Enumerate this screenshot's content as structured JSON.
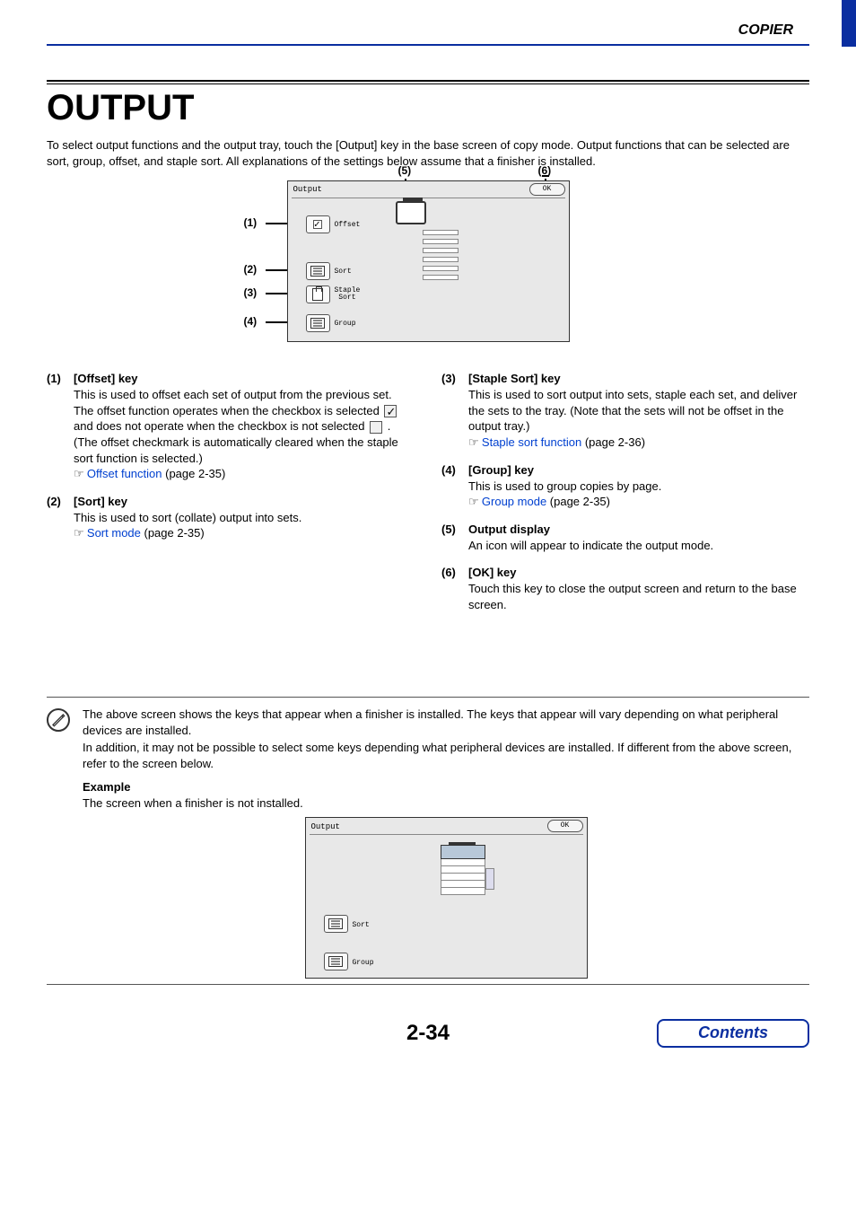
{
  "header": {
    "section": "COPIER"
  },
  "title": "OUTPUT",
  "intro": "To select output functions and the output tray, touch the [Output] key in the base screen of copy mode. Output functions that can be selected are sort, group, offset, and staple sort. All explanations of the settings below assume that a finisher is installed.",
  "diagram": {
    "panel_title": "Output",
    "ok": "OK",
    "btn_offset": "Offset",
    "btn_sort": "Sort",
    "btn_staple": "Staple\nSort",
    "btn_group": "Group",
    "callouts": {
      "c1": "(1)",
      "c2": "(2)",
      "c3": "(3)",
      "c4": "(4)",
      "c5": "(5)",
      "c6": "(6)"
    }
  },
  "items_left": [
    {
      "num": "(1)",
      "title": "[Offset] key",
      "p1": "This is used to offset each set of output from the previous set.",
      "p2a": "The offset function operates when the checkbox is selected ",
      "p2b": " and does not operate when the checkbox is not selected ",
      "p2c": " . (The offset checkmark is automatically cleared when the staple sort function is selected.)",
      "link": "Offset function",
      "link_suffix": " (page 2-35)"
    },
    {
      "num": "(2)",
      "title": "[Sort] key",
      "p1": "This is used to sort (collate) output into sets.",
      "link": "Sort mode",
      "link_suffix": " (page 2-35)"
    }
  ],
  "items_right": [
    {
      "num": "(3)",
      "title": "[Staple Sort] key",
      "p1": "This is used to sort output into sets, staple each set, and deliver the sets to the tray. (Note that the sets will not be offset in the output tray.)",
      "link": "Staple sort function",
      "link_suffix": " (page 2-36)"
    },
    {
      "num": "(4)",
      "title": "[Group] key",
      "p1": "This is used to group copies by page.",
      "link": "Group mode",
      "link_suffix": " (page 2-35)"
    },
    {
      "num": "(5)",
      "title": "Output display",
      "p1": "An icon will appear to indicate the output mode."
    },
    {
      "num": "(6)",
      "title": "[OK] key",
      "p1": "Touch this key to close the output screen and return to the base screen."
    }
  ],
  "note": {
    "p1": "The above screen shows the keys that appear when a finisher is installed. The keys that appear will vary depending on what peripheral devices are installed.",
    "p2": "In addition, it may not be possible to select some keys depending what peripheral devices are installed. If different from the above screen, refer to the screen below.",
    "example_label": "Example",
    "example_desc": "The screen when a finisher is not installed."
  },
  "diagram2": {
    "panel_title": "Output",
    "ok": "OK",
    "btn_sort": "Sort",
    "btn_group": "Group"
  },
  "footer": {
    "page": "2-34",
    "contents": "Contents"
  }
}
